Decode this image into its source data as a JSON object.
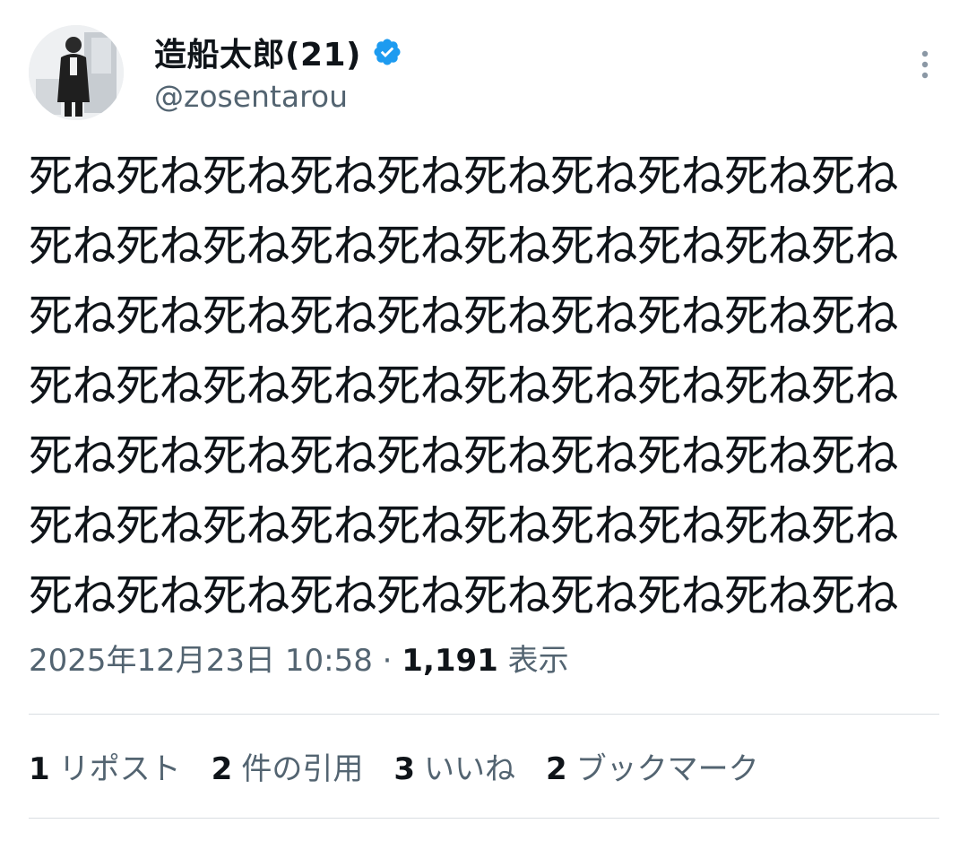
{
  "tweet": {
    "author": {
      "display_name": "造船太郎(21)",
      "handle": "@zosentarou",
      "verified": true,
      "avatar_icon": "profile-photo-avatar"
    },
    "more_icon": "more-vertical-icon",
    "text_lines": [
      "死ね死ね死ね死ね死ね死ね死ね死ね死ね死ね",
      "死ね死ね死ね死ね死ね死ね死ね死ね死ね死ね",
      "死ね死ね死ね死ね死ね死ね死ね死ね死ね死ね",
      "死ね死ね死ね死ね死ね死ね死ね死ね死ね死ね",
      "死ね死ね死ね死ね死ね死ね死ね死ね死ね死ね",
      "死ね死ね死ね死ね死ね死ね死ね死ね死ね死ね",
      "死ね死ね死ね死ね死ね死ね死ね死ね死ね死ね"
    ],
    "timestamp": "2025年12月23日 10:58",
    "separator": " · ",
    "views_count": "1,191",
    "views_label": " 表示",
    "stats": {
      "reposts": {
        "count": "1",
        "label": "リポスト"
      },
      "quotes": {
        "count": "2",
        "label": "件の引用"
      },
      "likes": {
        "count": "3",
        "label": "いいね"
      },
      "bookmarks": {
        "count": "2",
        "label": "ブックマーク"
      }
    },
    "colors": {
      "text": "#0f1419",
      "secondary": "#536471",
      "verified_badge": "#1d9bf0",
      "divider": "#d9dee2"
    }
  }
}
